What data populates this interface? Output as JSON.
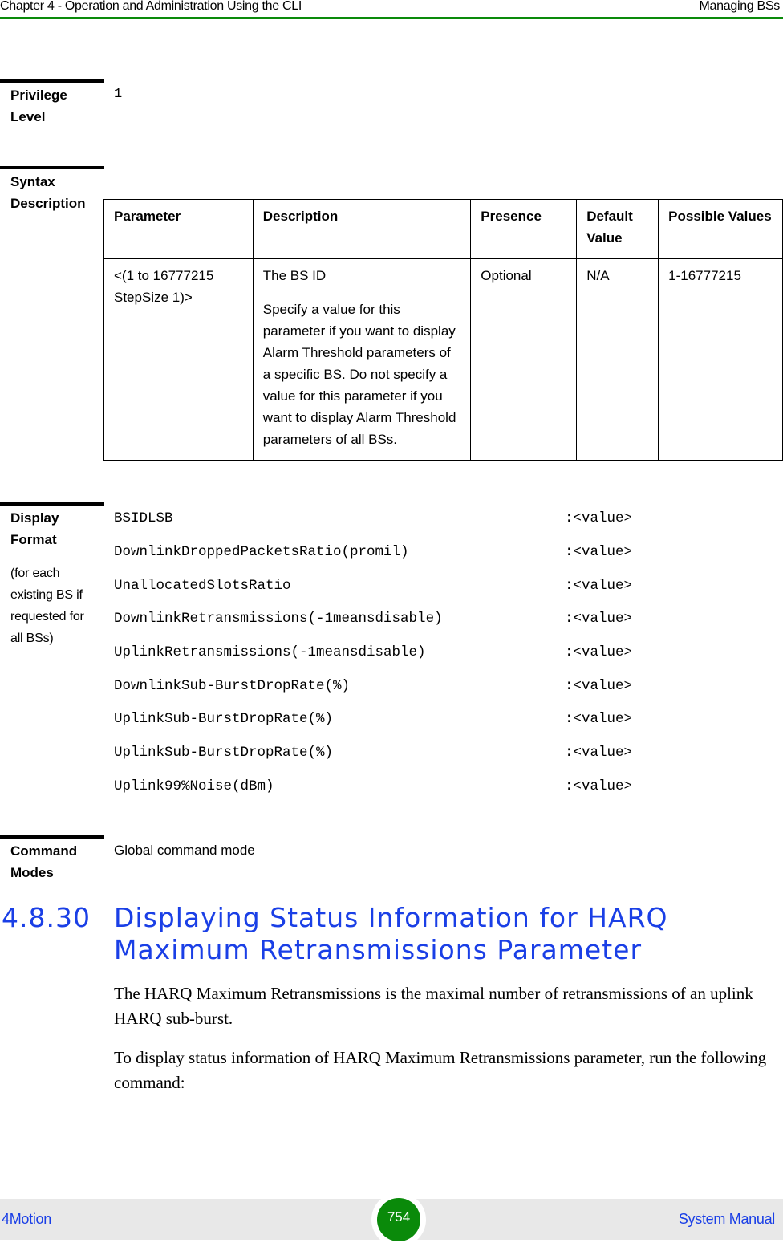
{
  "header": {
    "chapter": "Chapter 4 - Operation and Administration Using the CLI",
    "section": "Managing BSs",
    "accent_color": "#0a8a0a"
  },
  "privilege": {
    "label": "Privilege Level",
    "value": "1"
  },
  "syntax": {
    "label": "Syntax Description",
    "columns": [
      "Parameter",
      "Description",
      "Presence",
      "Default Value",
      "Possible Values"
    ],
    "rows": [
      {
        "parameter": "<(1 to 16777215 StepSize 1)>",
        "description_title": "The BS ID",
        "description_body": "Specify a value for this parameter if you want to display Alarm Threshold parameters of a specific BS. Do not specify a value for this parameter if you want to display Alarm Threshold parameters of all BSs.",
        "presence": "Optional",
        "default": "N/A",
        "possible": "1-16777215"
      }
    ]
  },
  "display_format": {
    "label": "Display Format",
    "note": "(for each existing BS if requested for all BSs)",
    "rows": [
      {
        "name": "BSIDLSB",
        "value": ":<value>"
      },
      {
        "name": "DownlinkDroppedPacketsRatio(promil)",
        "value": ":<value>"
      },
      {
        "name": "UnallocatedSlotsRatio",
        "value": ":<value>"
      },
      {
        "name": "DownlinkRetransmissions(-1meansdisable)",
        "value": ":<value>"
      },
      {
        "name": "UplinkRetransmissions(-1meansdisable)",
        "value": ":<value>"
      },
      {
        "name": "DownlinkSub-BurstDropRate(%)",
        "value": ":<value>"
      },
      {
        "name": "UplinkSub-BurstDropRate(%)",
        "value": ":<value>"
      },
      {
        "name": "UplinkSub-BurstDropRate(%)",
        "value": ":<value>"
      },
      {
        "name": "Uplink99%Noise(dBm)",
        "value": ":<value>"
      }
    ]
  },
  "command_modes": {
    "label": "Command Modes",
    "value": "Global command mode"
  },
  "section": {
    "number": "4.8.30",
    "title": "Displaying Status Information for HARQ Maximum Retransmissions Parameter",
    "color": "#1a3fe6",
    "paragraphs": [
      "The HARQ Maximum Retransmissions is the maximal number of retransmissions of an uplink HARQ sub-burst.",
      "To display status information of HARQ Maximum Retransmissions parameter, run the following command:"
    ]
  },
  "footer": {
    "product": "4Motion",
    "page_number": "754",
    "manual": "System Manual"
  }
}
